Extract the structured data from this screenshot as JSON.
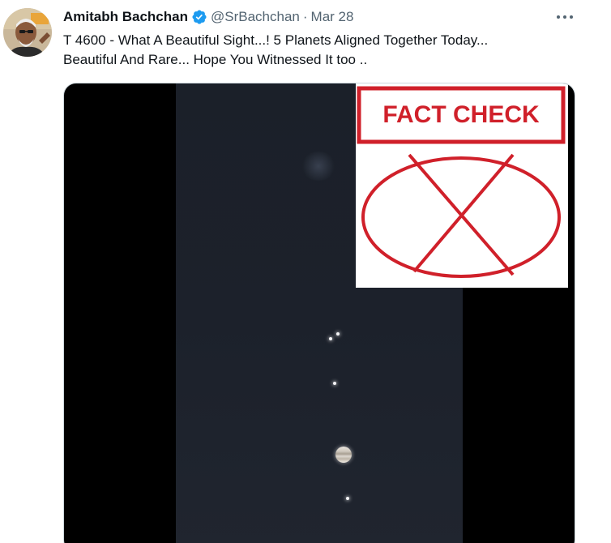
{
  "tweet": {
    "author_name": "Amitabh Bachchan",
    "handle": "@SrBachchan",
    "separator": "·",
    "date": "Mar 28",
    "text_line1": "T 4600 - What A Beautiful Sight...! 5 Planets Aligned Together Today...",
    "text_line2": "Beautiful And Rare... Hope You Witnessed It too .."
  },
  "media": {
    "overlay_label": "FACT CHECK",
    "overlay_color": "#d0202a",
    "sky_color": "#1c212b"
  },
  "icons": {
    "verified": "verified-badge-icon",
    "more": "more-icon"
  },
  "colors": {
    "text_primary": "#0f1419",
    "text_secondary": "#536471",
    "verified_blue": "#1d9bf0"
  }
}
